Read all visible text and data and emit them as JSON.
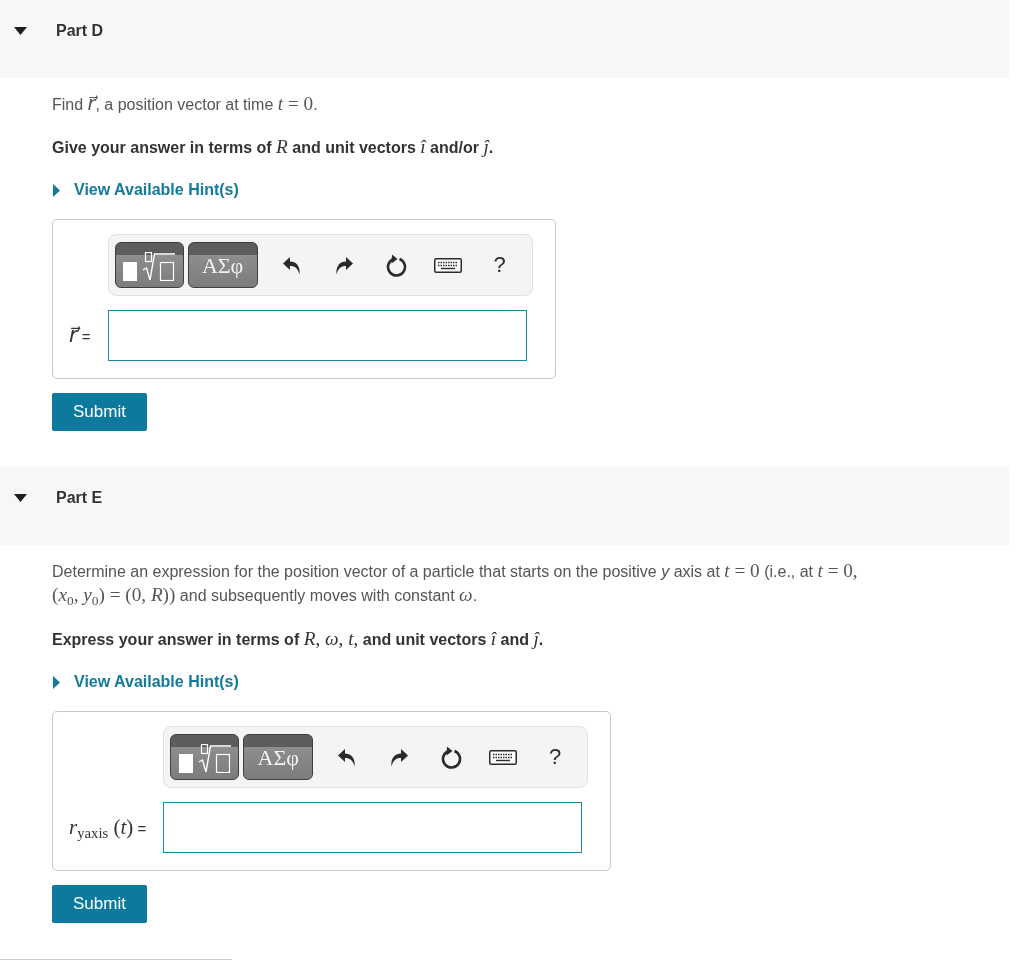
{
  "parts": [
    {
      "title": "Part D",
      "expanded": true,
      "prompt": [
        {
          "kind": "text",
          "text": "Find "
        },
        {
          "kind": "math",
          "text": "*r⃗*"
        },
        {
          "kind": "text",
          "text": ", a position vector at time "
        },
        {
          "kind": "math",
          "text": "*t* = 0"
        },
        {
          "kind": "text",
          "text": "."
        }
      ],
      "instruction": [
        {
          "kind": "text",
          "text": "Give your answer in terms of "
        },
        {
          "kind": "math",
          "text": "*R*"
        },
        {
          "kind": "text",
          "text": " and unit vectors "
        },
        {
          "kind": "math",
          "text": "*î*"
        },
        {
          "kind": "text",
          "text": " and/or "
        },
        {
          "kind": "math",
          "text": "*ĵ*"
        },
        {
          "kind": "text",
          "text": "."
        }
      ],
      "hint": {
        "label": "View Available Hint(s)",
        "expanded": false
      },
      "answer": {
        "toolbar": {
          "symbols_label": "ΑΣφ",
          "help_label": "?"
        },
        "label": [
          {
            "kind": "math",
            "text": "*r⃗*"
          },
          {
            "kind": "text",
            "text": " ="
          }
        ]
      },
      "submit": "Submit"
    },
    {
      "title": "Part E",
      "expanded": true,
      "prompt": [
        {
          "kind": "text",
          "text": "Determine an expression for the position vector of a particle that starts on the positive *y* axis at "
        },
        {
          "kind": "math",
          "text": "*t* = 0"
        },
        {
          "kind": "text",
          "text": " (i.e., at "
        },
        {
          "kind": "math",
          "text": "*t* = 0, "
        },
        {
          "kind": "math",
          "text": "(*x*$_{0}$, *y*$_{0}$) = (0, *R*))"
        },
        {
          "kind": "text",
          "text": " and subsequently moves with constant "
        },
        {
          "kind": "math",
          "text": "*ω*"
        },
        {
          "kind": "text",
          "text": "."
        }
      ],
      "instruction": [
        {
          "kind": "text",
          "text": "Express your answer in terms of "
        },
        {
          "kind": "math",
          "text": "*R*, *ω*, *t*,"
        },
        {
          "kind": "text",
          "text": " and unit vectors "
        },
        {
          "kind": "math",
          "text": "*î*"
        },
        {
          "kind": "text",
          "text": " and "
        },
        {
          "kind": "math",
          "text": "*ĵ*"
        },
        {
          "kind": "text",
          "text": "."
        }
      ],
      "hint": {
        "label": "View Available Hint(s)",
        "expanded": false
      },
      "answer": {
        "toolbar": {
          "symbols_label": "ΑΣφ",
          "help_label": "?"
        },
        "label": [
          {
            "kind": "math",
            "text": "*r*$_{yaxis}$ (*t*)"
          },
          {
            "kind": "text",
            "text": " ="
          }
        ]
      },
      "submit": "Submit"
    }
  ]
}
